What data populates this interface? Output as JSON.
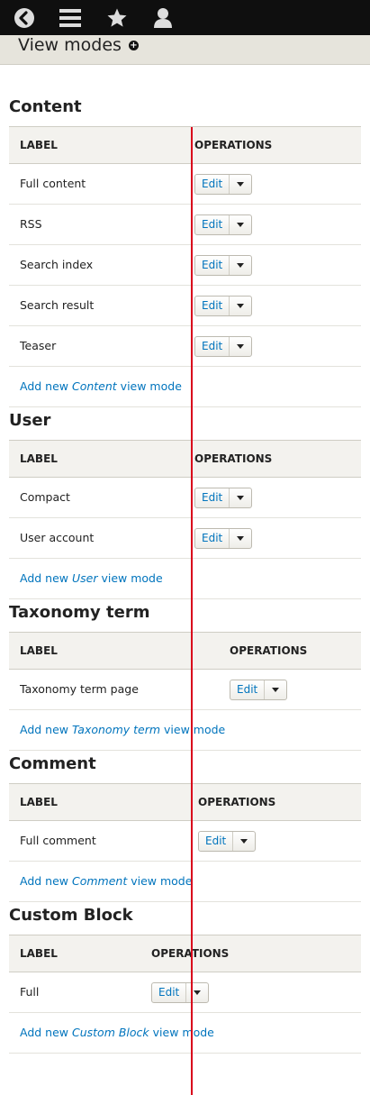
{
  "page": {
    "title": "View modes"
  },
  "toolbar": {
    "icons": [
      "back-icon",
      "menu-icon",
      "star-icon",
      "user-icon"
    ]
  },
  "headers": {
    "label": "LABEL",
    "operations": "OPERATIONS"
  },
  "edit_label": "Edit",
  "sections": [
    {
      "title": "Content",
      "rows": [
        "Full content",
        "RSS",
        "Search index",
        "Search result",
        "Teaser"
      ],
      "add": {
        "prefix": "Add new ",
        "entity": "Content",
        "suffix": " view mode"
      }
    },
    {
      "title": "User",
      "rows": [
        "Compact",
        "User account"
      ],
      "add": {
        "prefix": "Add new ",
        "entity": "User",
        "suffix": " view mode"
      }
    },
    {
      "title": "Taxonomy term",
      "rows": [
        "Taxonomy term page"
      ],
      "add": {
        "prefix": "Add new ",
        "entity": "Taxonomy term",
        "suffix": " view mode"
      }
    },
    {
      "title": "Comment",
      "rows": [
        "Full comment"
      ],
      "add": {
        "prefix": "Add new ",
        "entity": "Comment",
        "suffix": " view mode"
      }
    },
    {
      "title": "Custom Block",
      "rows": [
        "Full"
      ],
      "add": {
        "prefix": "Add new ",
        "entity": "Custom Block",
        "suffix": " view mode"
      }
    }
  ]
}
